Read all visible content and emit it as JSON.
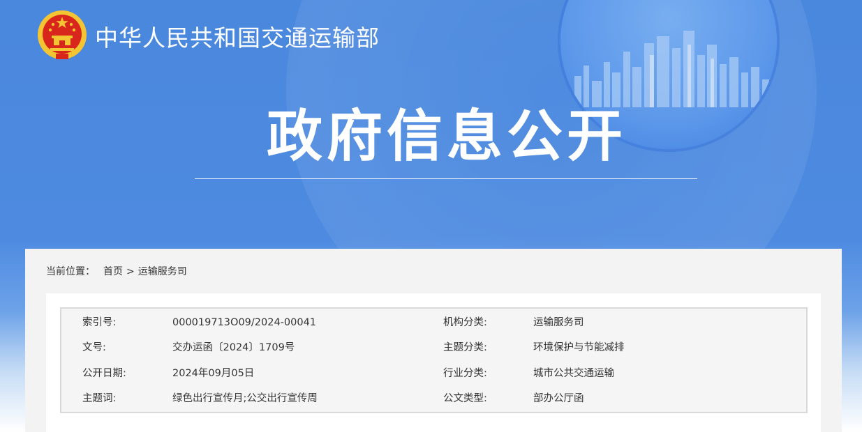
{
  "header": {
    "ministry_name": "中华人民共和国交通运输部",
    "section_title": "政府信息公开"
  },
  "breadcrumb": {
    "label": "当前位置：",
    "home": "首页",
    "separator": ">",
    "current": "运输服务司"
  },
  "metadata": {
    "rows": [
      {
        "left_key": "索引号:",
        "left_value": "000019713O09/2024-00041",
        "right_key": "机构分类:",
        "right_value": "运输服务司"
      },
      {
        "left_key": "文号:",
        "left_value": "交办运函〔2024〕1709号",
        "right_key": "主题分类:",
        "right_value": "环境保护与节能减排"
      },
      {
        "left_key": "公开日期:",
        "left_value": "2024年09月05日",
        "right_key": "行业分类:",
        "right_value": "城市公共交通运输"
      },
      {
        "left_key": "主题词:",
        "left_value": "绿色出行宣传月;公交出行宣传周",
        "right_key": "公文类型:",
        "right_value": "部办公厅函"
      }
    ]
  },
  "colors": {
    "banner_blue": "#4a88de",
    "emblem_red": "#d9261c",
    "emblem_gold": "#f3c532"
  },
  "icons": {
    "emblem": "national-emblem-icon",
    "skyline": "city-skyline-icon"
  }
}
